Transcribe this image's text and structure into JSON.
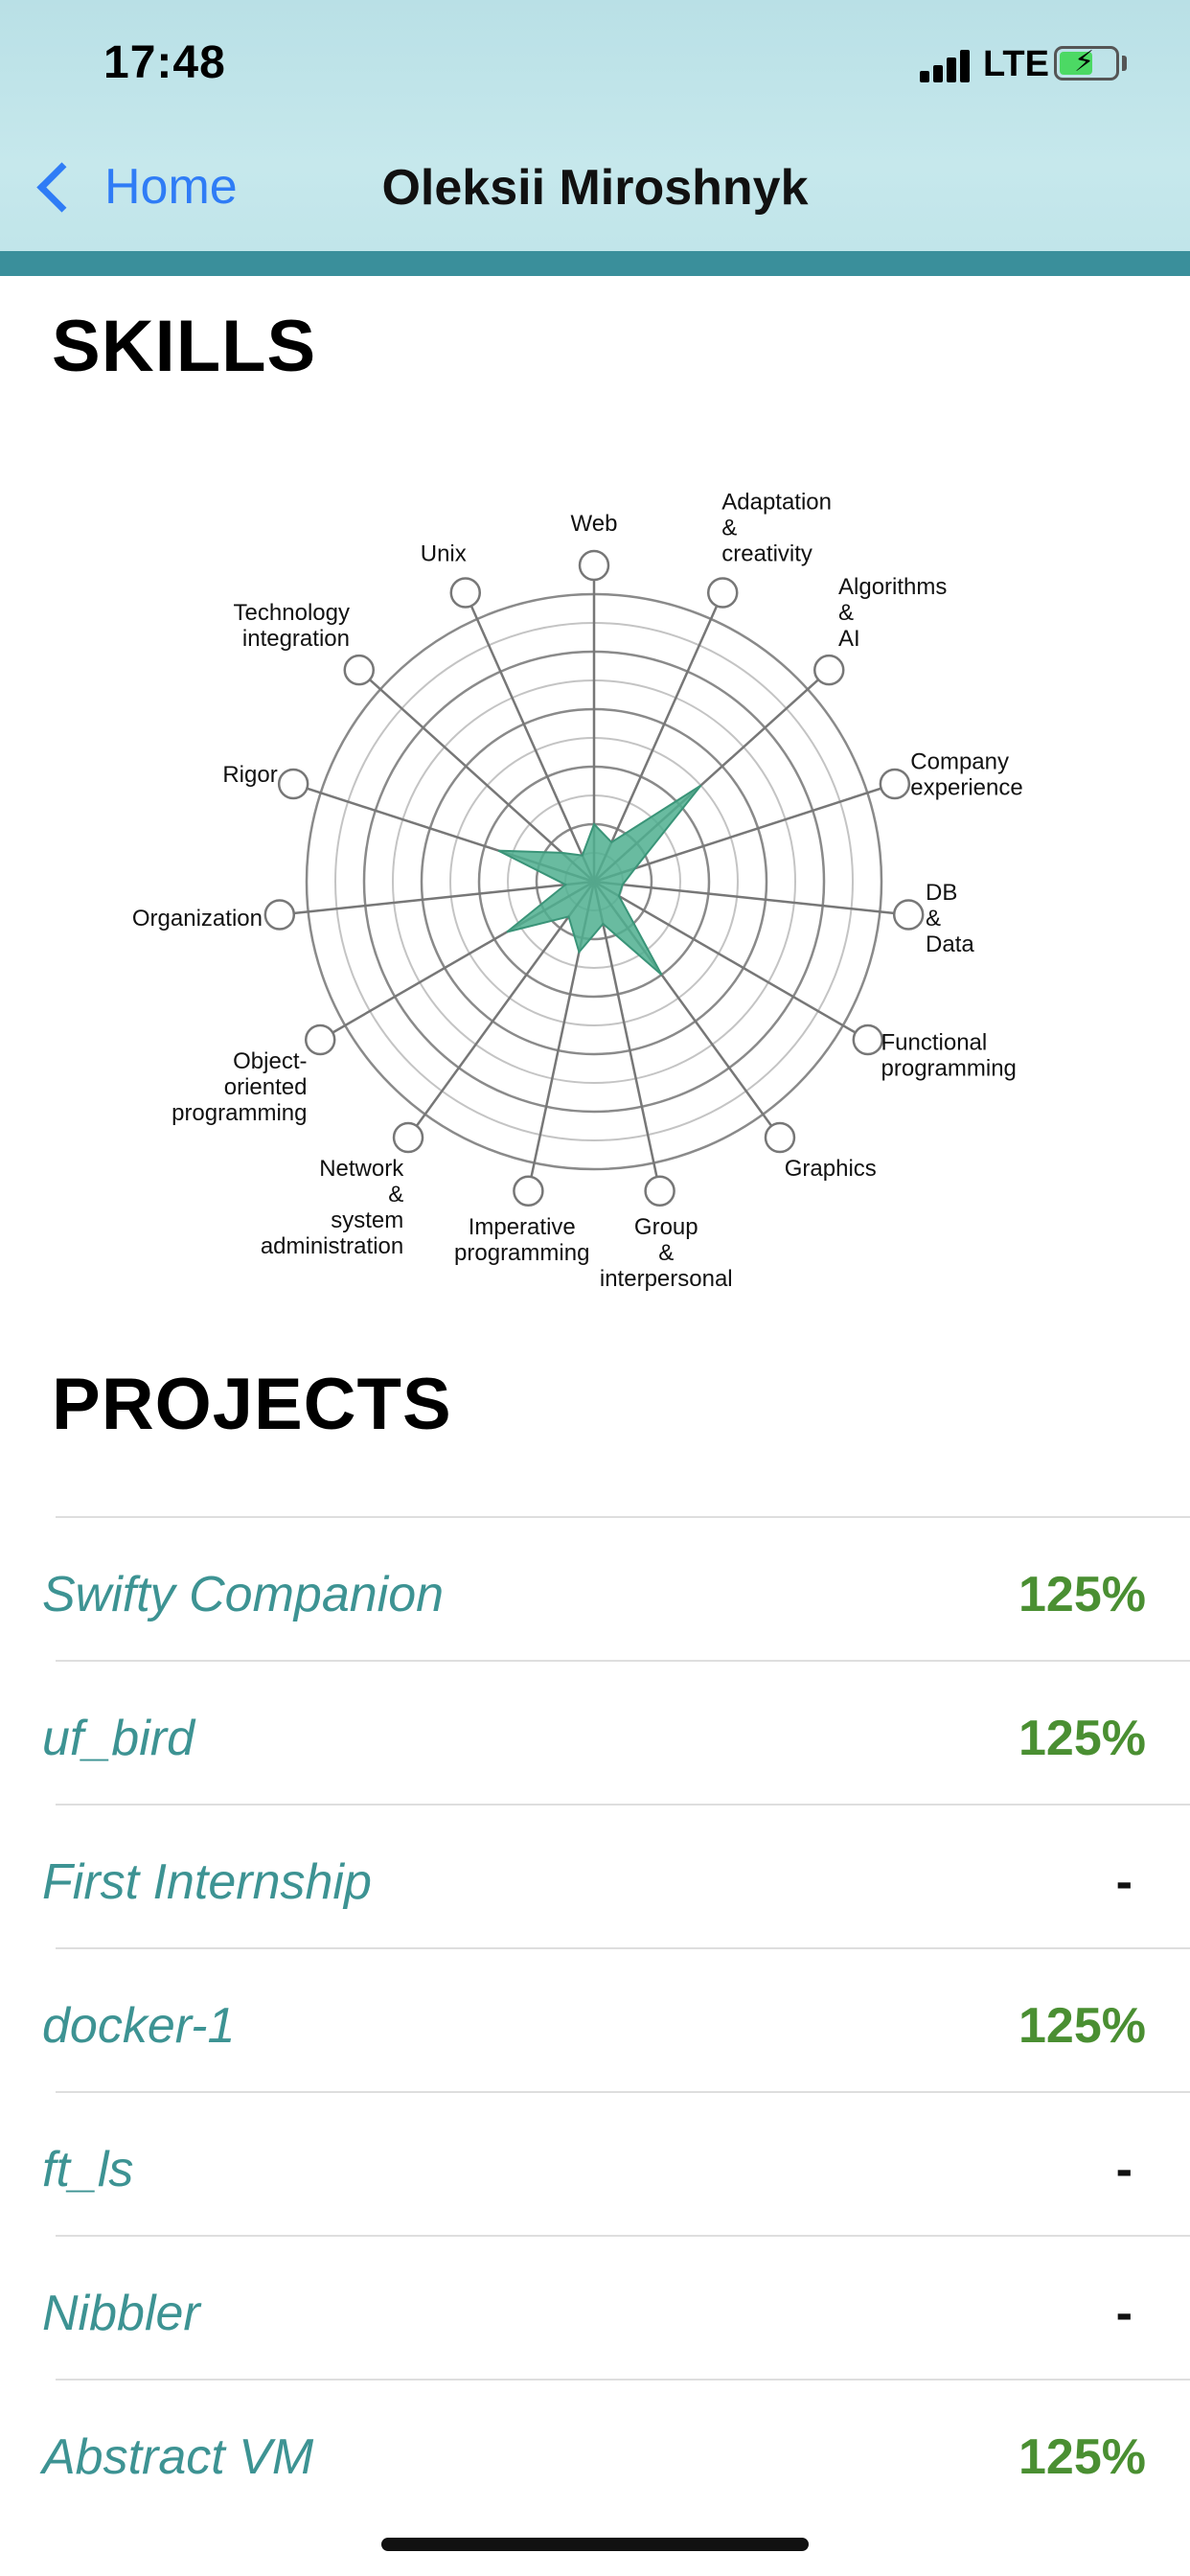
{
  "status_bar": {
    "time": "17:48",
    "network": "LTE"
  },
  "nav": {
    "back_label": "Home",
    "title": "Oleksii Miroshnyk"
  },
  "skills": {
    "title": "SKILLS"
  },
  "projects": {
    "title": "PROJECTS",
    "items": [
      {
        "name": "Swifty Companion",
        "score": "125%"
      },
      {
        "name": "uf_bird",
        "score": "125%"
      },
      {
        "name": "First Internship",
        "score": "-"
      },
      {
        "name": "docker-1",
        "score": "125%"
      },
      {
        "name": "ft_ls",
        "score": "-"
      },
      {
        "name": "Nibbler",
        "score": "-"
      },
      {
        "name": "Abstract VM",
        "score": "125%"
      }
    ]
  },
  "chart_data": {
    "type": "radar",
    "categories": [
      "Web",
      "Adaptation & creativity",
      "Algorithms & AI",
      "Company experience",
      "DB & Data",
      "Functional programming",
      "Graphics",
      "Group & interpersonal",
      "Imperative programming",
      "Network & system administration",
      "Object-oriented programming",
      "Organization",
      "Rigor",
      "Technology integration",
      "Unix"
    ],
    "values": [
      2.0,
      1.5,
      5.0,
      1.5,
      1.0,
      1.0,
      4.0,
      1.5,
      2.5,
      1.5,
      3.5,
      1.0,
      3.5,
      1.5,
      1.0
    ],
    "rmax": 10,
    "rings": 10,
    "colors": {
      "fill": "#4faf8f",
      "stroke": "#3a9478",
      "grid_major": "#8a8a8a",
      "grid_minor": "#c4c4c4"
    }
  },
  "colors": {
    "accent_link": "#2f7cf6",
    "project_name": "#3d9393",
    "score_green": "#4a8f32"
  },
  "icons": {
    "back": "chevron-left-icon",
    "signal": "cellular-signal-icon",
    "battery": "battery-charging-icon"
  }
}
